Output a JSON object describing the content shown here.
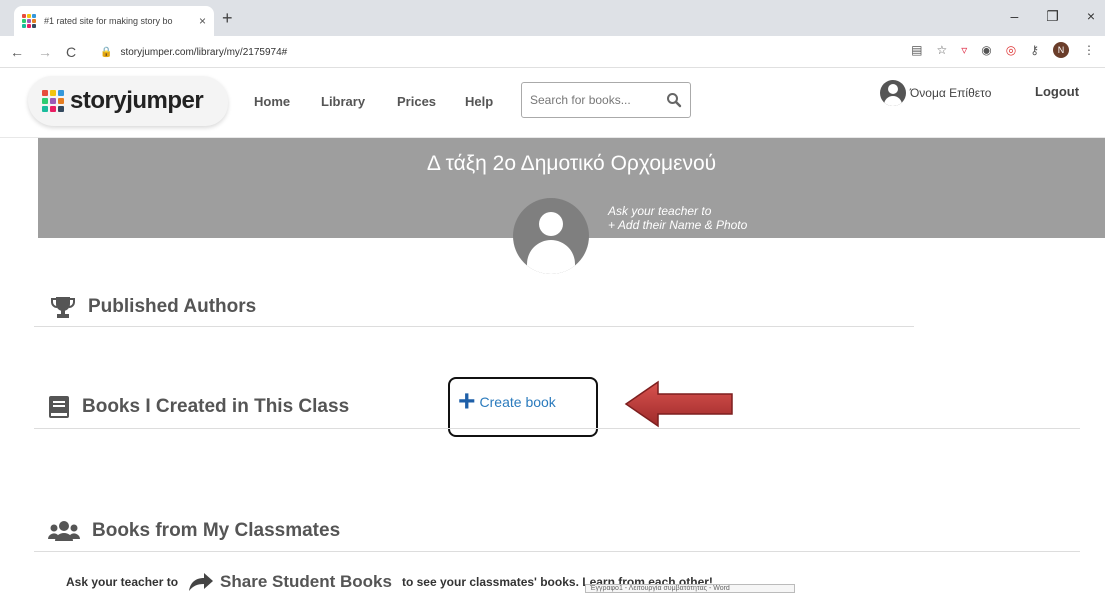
{
  "browser": {
    "tab_title": "#1 rated site for making story bo",
    "tab_close": "×",
    "new_tab": "+",
    "back": "←",
    "forward": "→",
    "reload": "C",
    "url": "storyjumper.com/library/my/2175974#",
    "window_minimize": "–",
    "window_restore": "❐",
    "window_close": "×",
    "profile_initial": "N"
  },
  "site": {
    "logo_text": "storyjumper",
    "nav": {
      "home": "Home",
      "library": "Library",
      "prices": "Prices",
      "help": "Help"
    },
    "search_placeholder": "Search for books...",
    "user_name": "Όνομα Επίθετο",
    "logout": "Logout"
  },
  "banner": {
    "class_name": "Δ τάξη 2ο Δημοτικό Ορχομενού",
    "hint_line1": "Ask your teacher to",
    "hint_line2": "+ Add their Name & Photo"
  },
  "sections": {
    "published_authors": "Published Authors",
    "books_created": "Books I Created in This Class",
    "create_book": "Create book",
    "classmates": "Books from My Classmates",
    "share_prefix": "Ask your teacher to",
    "share_label": "Share Student Books",
    "share_suffix": "to see your classmates' books. Learn from each other!"
  },
  "taskbar_tooltip": "Έγγραφο1 - Λειτουργία συμβατότητας - Word",
  "colors": {
    "banner": "#9e9e9e",
    "link": "#2b7bbd",
    "arrow": "#c0392b"
  }
}
